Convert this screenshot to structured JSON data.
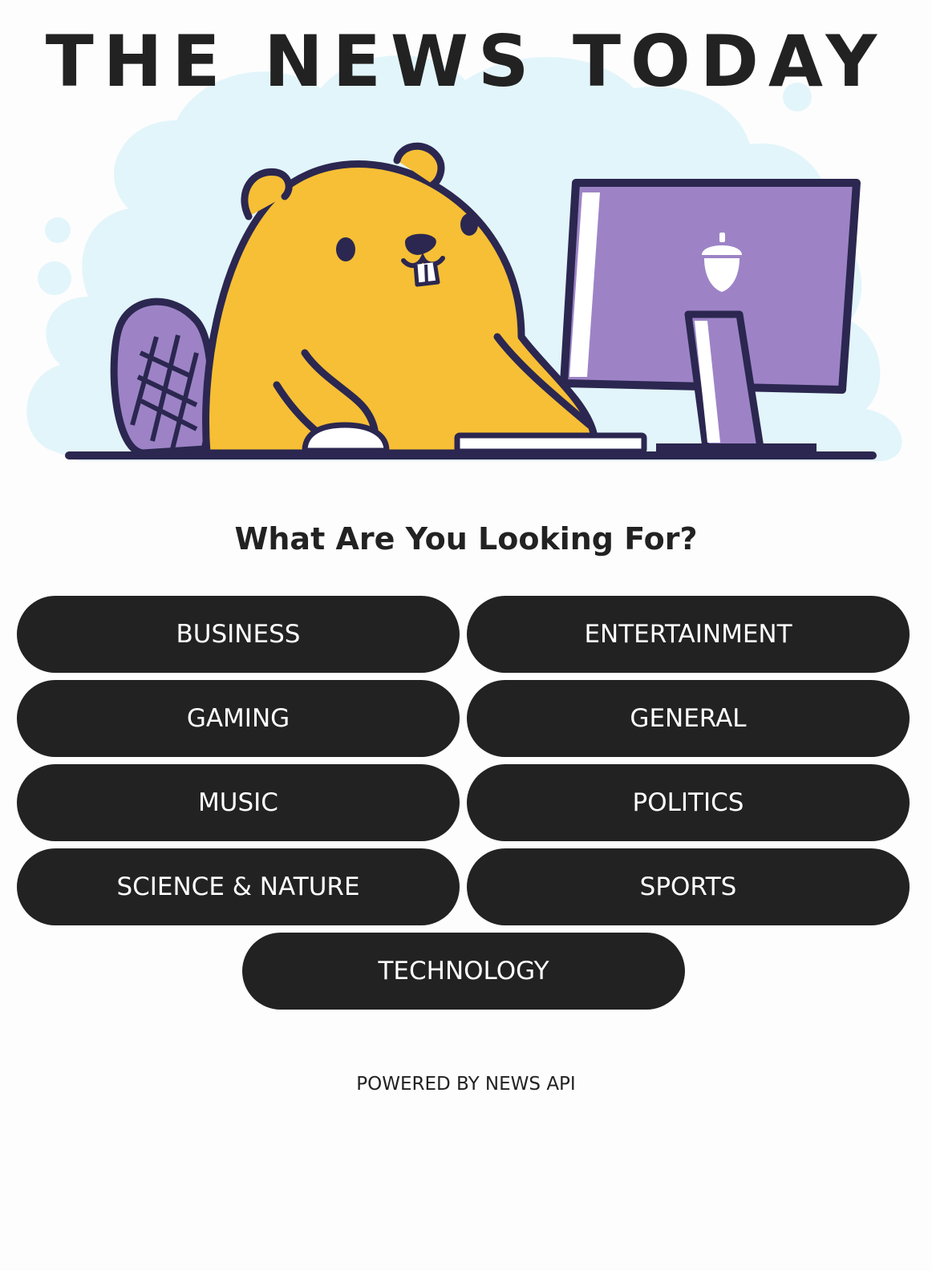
{
  "header": {
    "title": "THE NEWS TODAY"
  },
  "hero": {
    "illustration": "beaver-at-computer",
    "icons": [
      "acorn-icon"
    ]
  },
  "prompt": "What Are You Looking For?",
  "categories": [
    {
      "label": "BUSINESS"
    },
    {
      "label": "ENTERTAINMENT"
    },
    {
      "label": "GAMING"
    },
    {
      "label": "GENERAL"
    },
    {
      "label": "MUSIC"
    },
    {
      "label": "POLITICS"
    },
    {
      "label": "SCIENCE & NATURE"
    },
    {
      "label": "SPORTS"
    },
    {
      "label": "TECHNOLOGY"
    }
  ],
  "footer": {
    "text": "POWERED BY NEWS API"
  },
  "colors": {
    "background": "#fdfdfd",
    "text": "#222222",
    "button": "#222222",
    "button_text": "#ffffff",
    "beaver": "#f6bf35",
    "outline": "#2b2750",
    "monitor": "#9d83c6",
    "cloud": "#e2f5fa"
  }
}
